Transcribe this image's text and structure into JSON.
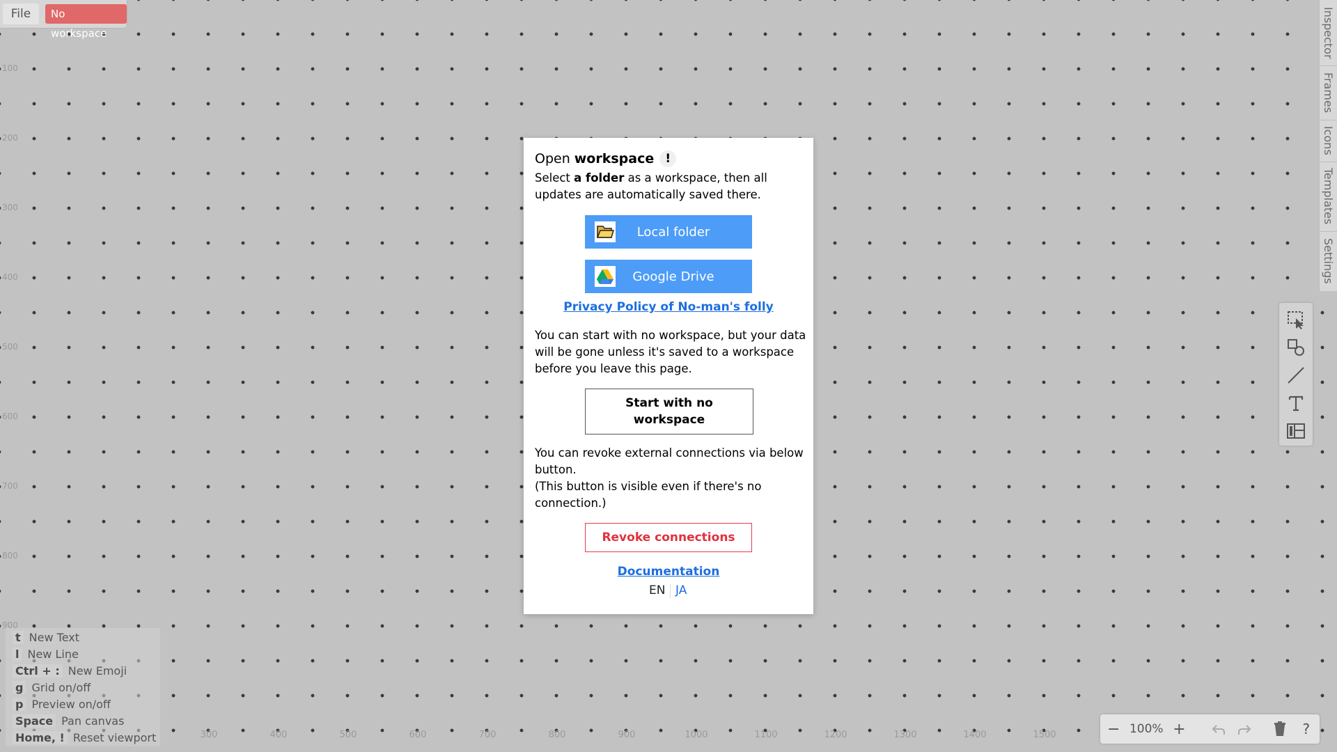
{
  "toolbar": {
    "file_label": "File",
    "workspace_status": "No workspace"
  },
  "side_tabs": [
    "Inspector",
    "Frames",
    "Icons",
    "Templates",
    "Settings"
  ],
  "rulers": {
    "y": [
      "100",
      "200",
      "300",
      "400",
      "500",
      "600",
      "700",
      "800",
      "900"
    ],
    "x": [
      "300",
      "400",
      "500",
      "600",
      "700",
      "800",
      "900",
      "1000",
      "1100",
      "1200",
      "1300",
      "1400",
      "1500"
    ]
  },
  "tools": [
    "select-area-icon",
    "shapes-icon",
    "line-icon",
    "text-icon",
    "layout-icon"
  ],
  "shortcuts": [
    {
      "key": "t",
      "label": "New Text"
    },
    {
      "key": "l",
      "label": "New Line"
    },
    {
      "key": "Ctrl + :",
      "label": "New Emoji"
    },
    {
      "key": "g",
      "label": "Grid on/off"
    },
    {
      "key": "p",
      "label": "Preview on/off"
    },
    {
      "key": "Space",
      "label": "Pan canvas"
    },
    {
      "key": "Home, !",
      "label": "Reset viewport"
    }
  ],
  "zoom": {
    "level": "100%",
    "minus": "−",
    "plus": "+",
    "help": "?"
  },
  "dialog": {
    "title_prefix": "Open",
    "title_bold": "workspace",
    "title_help": "!",
    "intro_1": "Select",
    "intro_bold": "a folder",
    "intro_2": "as a workspace, then all updates are automatically saved there.",
    "local_folder_label": "Local folder",
    "google_drive_label": "Google Drive",
    "privacy_link": "Privacy Policy of No-man's folly",
    "no_workspace_note": "You can start with no workspace, but your data will be gone unless it's saved to a workspace before you leave this page.",
    "start_no_workspace_label": "Start with no workspace",
    "revoke_note_1": "You can revoke external connections via below button.",
    "revoke_note_2": "(This button is visible even if there's no connection.)",
    "revoke_label": "Revoke connections",
    "documentation_link": "Documentation",
    "lang_en": "EN",
    "lang_ja": "JA"
  }
}
